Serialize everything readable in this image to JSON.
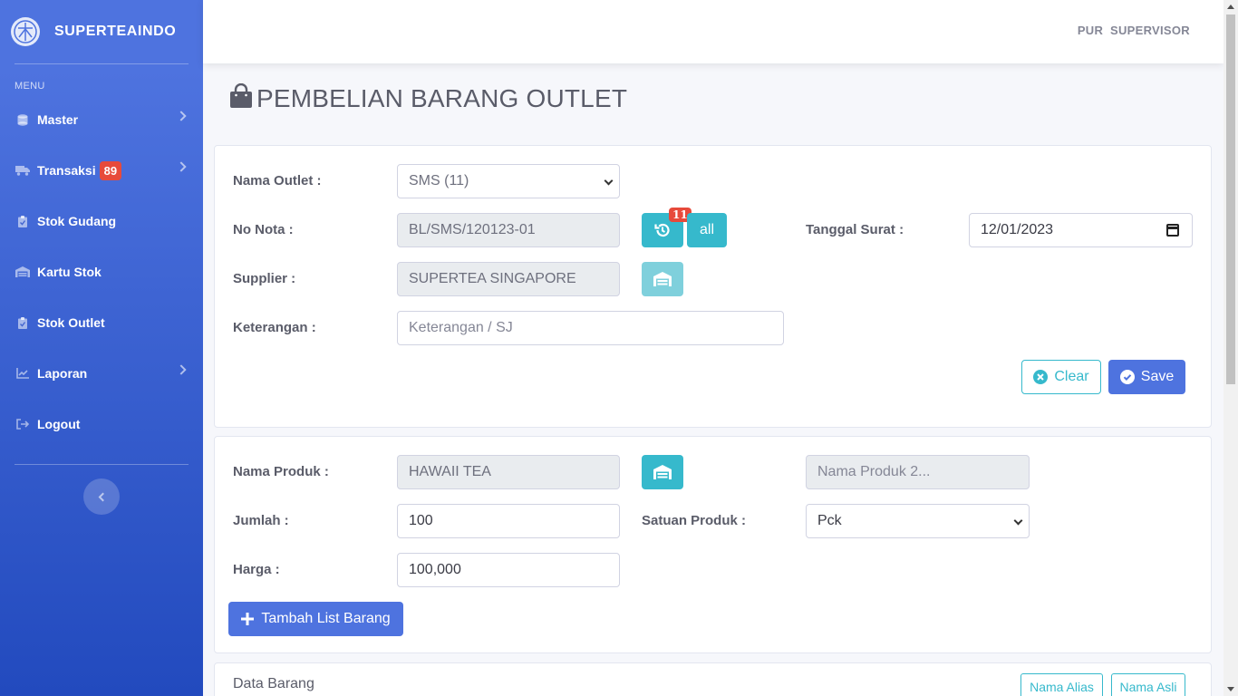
{
  "brand": {
    "name": "SUPERTEAINDO"
  },
  "sidebar": {
    "heading": "MENU",
    "items": [
      {
        "label": "Master",
        "icon": "database-icon",
        "chevron": true
      },
      {
        "label": "Transaksi",
        "icon": "truck-icon",
        "badge": "89",
        "chevron": true
      },
      {
        "label": "Stok Gudang",
        "icon": "clipboard-check-icon"
      },
      {
        "label": "Kartu Stok",
        "icon": "warehouse-icon"
      },
      {
        "label": "Stok Outlet",
        "icon": "clipboard-check-icon"
      },
      {
        "label": "Laporan",
        "icon": "chart-line-icon",
        "chevron": true
      },
      {
        "label": "Logout",
        "icon": "sign-out-icon"
      }
    ]
  },
  "topbar": {
    "user": "PUR  SUPERVISOR"
  },
  "page": {
    "title": "PEMBELIAN BARANG OUTLET"
  },
  "form_header": {
    "outlet_label": "Nama Outlet :",
    "outlet_value": "SMS (11)",
    "nota_label": "No Nota :",
    "nota_value": "BL/SMS/120123-01",
    "history_badge": "11",
    "all_label": "all",
    "tanggal_label": "Tanggal Surat :",
    "tanggal_value": "12/01/2023",
    "supplier_label": "Supplier :",
    "supplier_value": "SUPERTEA SINGAPORE",
    "keterangan_label": "Keterangan :",
    "keterangan_placeholder": "Keterangan / SJ",
    "clear_label": "Clear",
    "save_label": "Save"
  },
  "form_item": {
    "produk_label": "Nama Produk :",
    "produk_value": "HAWAII TEA",
    "produk2_placeholder": "Nama Produk 2...",
    "jumlah_label": "Jumlah :",
    "jumlah_value": "100",
    "satuan_label": "Satuan Produk :",
    "satuan_value": "Pck",
    "harga_label": "Harga :",
    "harga_value": "100,000",
    "tambah_label": "Tambah List Barang"
  },
  "data_barang": {
    "title": "Data Barang",
    "btn_alias": "Nama Alias",
    "btn_asli": "Nama Asli"
  },
  "colors": {
    "primary": "#4e73df",
    "info": "#36b9cc",
    "danger": "#e74a3b"
  }
}
